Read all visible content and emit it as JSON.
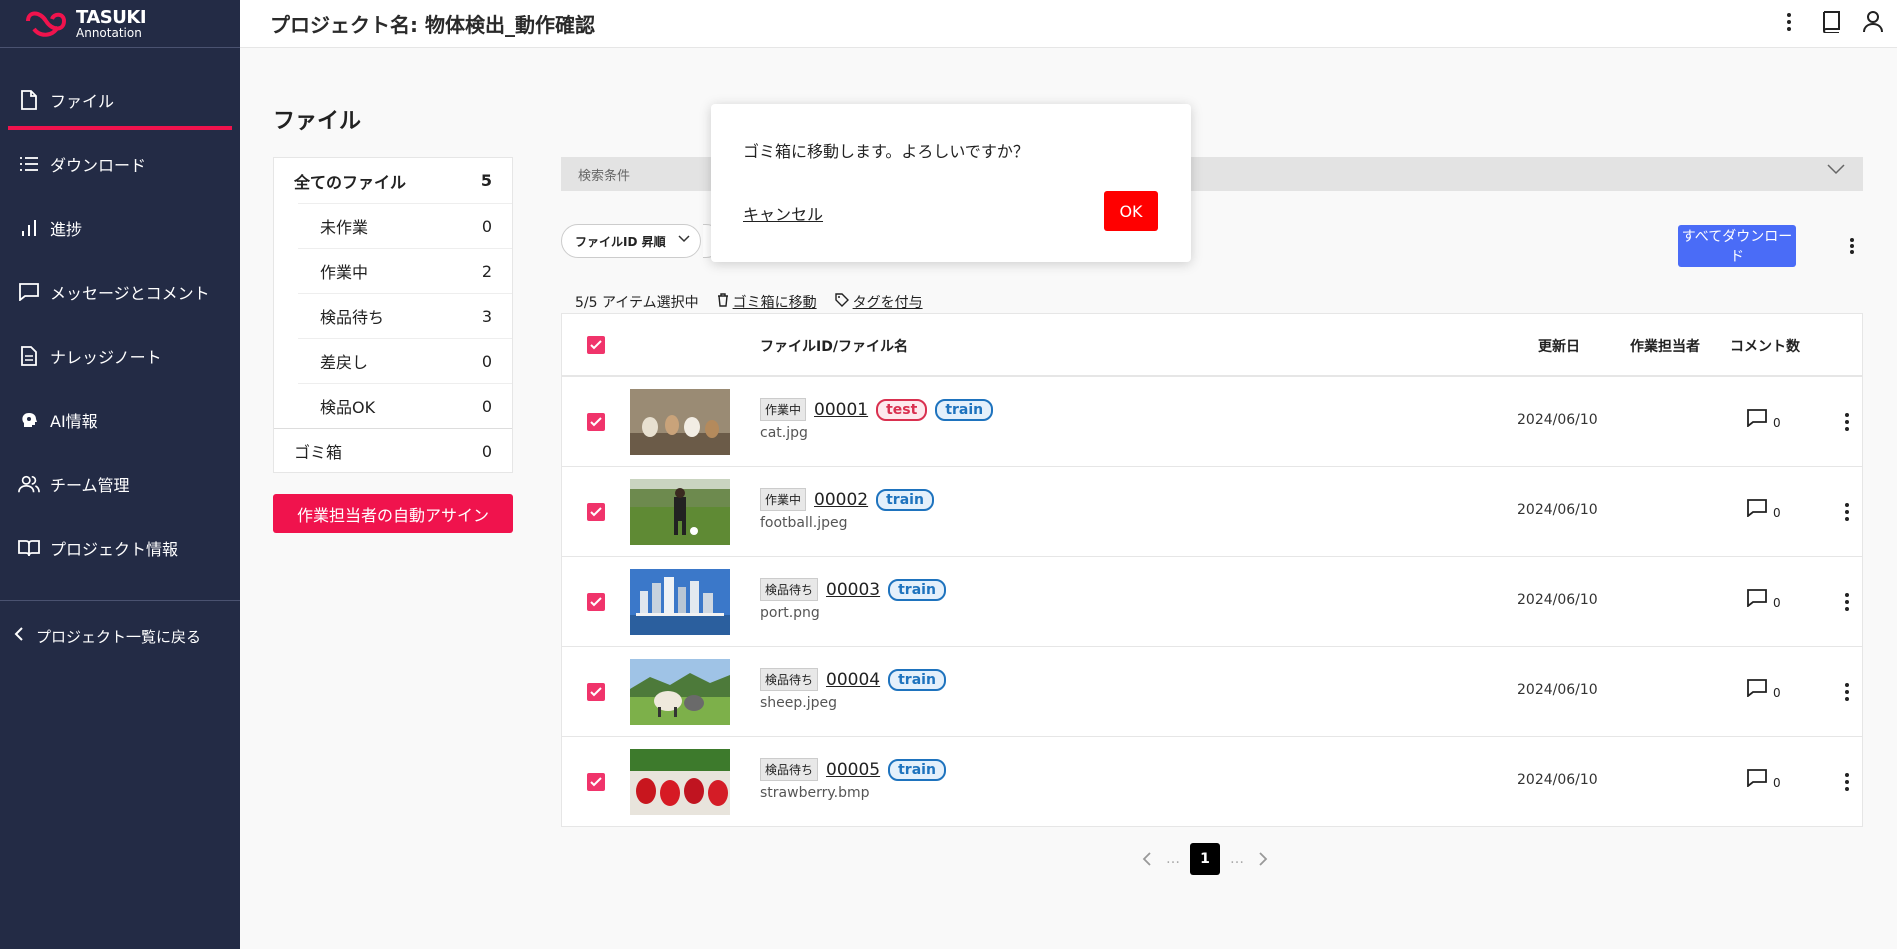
{
  "logo": {
    "line1": "TASUKI",
    "line2": "Annotation"
  },
  "sidebar": {
    "items": [
      {
        "label": "ファイル",
        "icon": "file-icon"
      },
      {
        "label": "ダウンロード",
        "icon": "list-icon"
      },
      {
        "label": "進捗",
        "icon": "bar-chart-icon"
      },
      {
        "label": "メッセージとコメント",
        "icon": "message-icon"
      },
      {
        "label": "ナレッジノート",
        "icon": "document-icon"
      },
      {
        "label": "AI情報",
        "icon": "ai-head-icon"
      },
      {
        "label": "チーム管理",
        "icon": "team-icon"
      },
      {
        "label": "プロジェクト情報",
        "icon": "book-icon"
      }
    ],
    "back_label": "プロジェクト一覧に戻る"
  },
  "header": {
    "title": "プロジェクト名: 物体検出_動作確認"
  },
  "page_title": "ファイル",
  "filters": {
    "all": {
      "label": "全てのファイル",
      "count": "5"
    },
    "subs": [
      {
        "label": "未作業",
        "count": "0"
      },
      {
        "label": "作業中",
        "count": "2"
      },
      {
        "label": "検品待ち",
        "count": "3"
      },
      {
        "label": "差戻し",
        "count": "0"
      },
      {
        "label": "検品OK",
        "count": "0"
      }
    ],
    "trash": {
      "label": "ゴミ箱",
      "count": "0"
    },
    "assign_button": "作業担当者の自動アサイン"
  },
  "search": {
    "label": "検索条件"
  },
  "sort": {
    "label": "ファイルID 昇順"
  },
  "download_all": "すべてダウンロード",
  "selection": {
    "count_text": "5/5 アイテム選択中",
    "trash_action": "ゴミ箱に移動",
    "tag_action": "タグを付与"
  },
  "table": {
    "headers": {
      "name": "ファイルID/ファイル名",
      "date": "更新日",
      "assignee": "作業担当者",
      "comments": "コメント数"
    },
    "rows": [
      {
        "status": "作業中",
        "id": "00001",
        "tags": [
          "test",
          "train"
        ],
        "file": "cat.jpg",
        "date": "2024/06/10",
        "comments": "0"
      },
      {
        "status": "作業中",
        "id": "00002",
        "tags": [
          "train"
        ],
        "file": "football.jpeg",
        "date": "2024/06/10",
        "comments": "0"
      },
      {
        "status": "検品待ち",
        "id": "00003",
        "tags": [
          "train"
        ],
        "file": "port.png",
        "date": "2024/06/10",
        "comments": "0"
      },
      {
        "status": "検品待ち",
        "id": "00004",
        "tags": [
          "train"
        ],
        "file": "sheep.jpeg",
        "date": "2024/06/10",
        "comments": "0"
      },
      {
        "status": "検品待ち",
        "id": "00005",
        "tags": [
          "train"
        ],
        "file": "strawberry.bmp",
        "date": "2024/06/10",
        "comments": "0"
      }
    ]
  },
  "pager": {
    "current": "1",
    "ellipsis": "…"
  },
  "dialog": {
    "message": "ゴミ箱に移動します。よろしいですか？",
    "cancel": "キャンセル",
    "ok": "OK"
  },
  "colors": {
    "sidebar": "#232b45",
    "accent": "#f0134d",
    "primary": "#4a6cf7",
    "checkbox": "#f0346b"
  }
}
